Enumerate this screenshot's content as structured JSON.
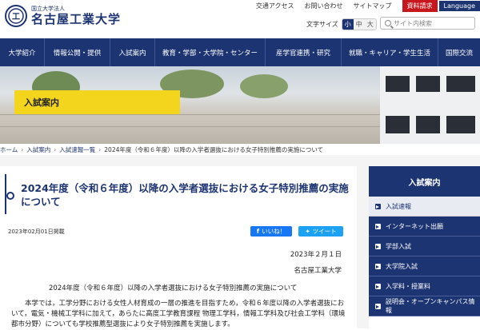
{
  "header": {
    "logo_mark": "名工大",
    "logo_small": "国立大学法人",
    "logo_name": "名古屋工業大学",
    "top_links": [
      "交通アクセス",
      "お問い合わせ",
      "サイトマップ"
    ],
    "request_label": "資料請求",
    "language_label": "Language",
    "font_size_label": "文字サイズ",
    "font_sizes": [
      "小",
      "中",
      "大"
    ],
    "search_placeholder": "サイト内検索"
  },
  "nav": [
    "大学紹介",
    "情報公開・提供",
    "入試案内",
    "教育・学部・大学院・センター",
    "産学官連携・研究",
    "就職・キャリア・学生生活",
    "国際交流"
  ],
  "hero": {
    "label": "入試案内"
  },
  "breadcrumb": [
    "ホーム",
    "入試案内",
    "入試速報一覧",
    "2024年度（令和６年度）以降の入学者選抜における女子特別推薦の実施について"
  ],
  "article": {
    "title": "2024年度（令和６年度）以降の入学者選抜における女子特別推薦の実施について",
    "published": "2023年02月01日掲載",
    "like_label": "いいね！",
    "tweet_label": "ツイート",
    "date": "2023年２月１日",
    "org": "名古屋工業大学",
    "heading": "2024年度（令和６年度）以降の入学者選抜における女子特別推薦の実施について",
    "paragraph": "本学では，工学分野における女性人材育成の一層の推進を目指すため，令和６年度以降の入学者選抜において，電気・機械工学科に加えて，あらたに高度工学教育課程 物理工学科，情報工学科及び社会工学科（環境都市分野）についても学校推薦型選抜により女子特別推薦を実施します。"
  },
  "sidebar": {
    "title": "入試案内",
    "items": [
      "入試速報",
      "インターネット出願",
      "学部入試",
      "大学院入試",
      "入学料・授業料",
      "説明会・オープンキャンパス情報"
    ]
  },
  "colors": {
    "primary": "#1d3472",
    "accent": "#f2d51c",
    "request": "#c8161d"
  }
}
